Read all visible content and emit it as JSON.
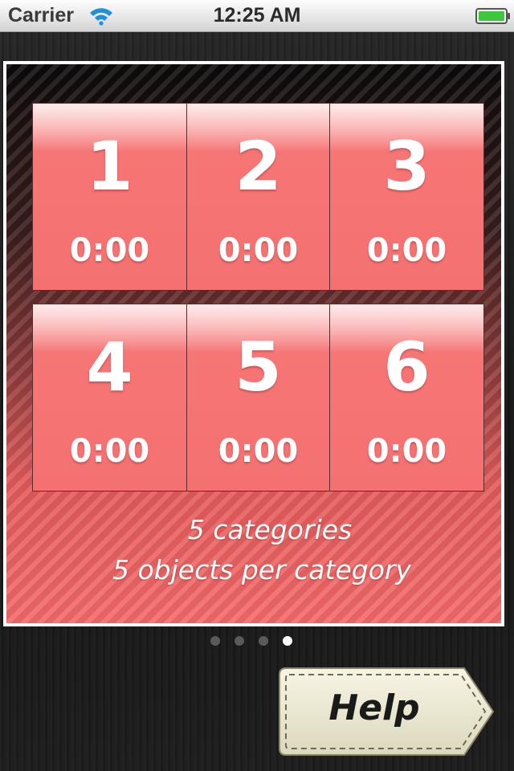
{
  "status_bar": {
    "carrier": "Carrier",
    "time": "12:25 AM",
    "wifi_icon": "wifi-icon",
    "battery_icon": "battery-full-icon",
    "battery_color": "#3fc63f"
  },
  "levels": [
    {
      "number": "1",
      "time": "0:00"
    },
    {
      "number": "2",
      "time": "0:00"
    },
    {
      "number": "3",
      "time": "0:00"
    },
    {
      "number": "4",
      "time": "0:00"
    },
    {
      "number": "5",
      "time": "0:00"
    },
    {
      "number": "6",
      "time": "0:00"
    }
  ],
  "panel": {
    "categories_text": "5 categories",
    "objects_text": "5 objects per category",
    "tile_color": "#f57171",
    "border_color": "#ffffff"
  },
  "pager": {
    "page_count": 4,
    "current_page": 4
  },
  "help_button": {
    "label": "Help",
    "fill_color": "#efecd6"
  }
}
